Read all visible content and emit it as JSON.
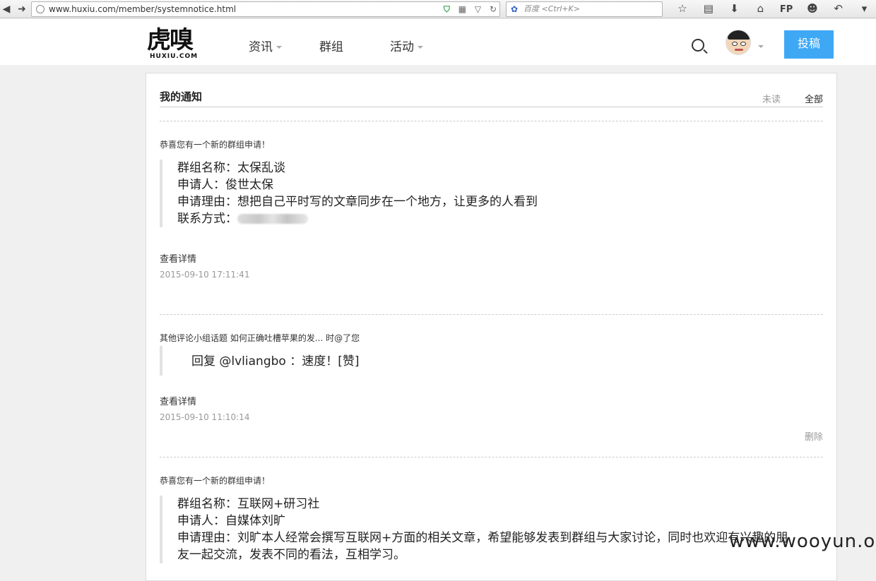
{
  "browser": {
    "url": "www.huxiu.com/member/systemnotice.html",
    "search_placeholder": "百度 <Ctrl+K>",
    "fp_label": "FP"
  },
  "header": {
    "logo_cn": "虎嗅",
    "logo_en": "HUXIU.COM",
    "nav": [
      {
        "label": "资讯",
        "dropdown": true
      },
      {
        "label": "群组",
        "dropdown": false
      },
      {
        "label": "活动",
        "dropdown": true
      }
    ],
    "submit_label": "投稿",
    "accent": "#3ea8f5"
  },
  "notices_panel": {
    "title": "我的通知",
    "filter_unread": "未读",
    "filter_all": "全部"
  },
  "notices": [
    {
      "title": "恭喜您有一个新的群组申请！",
      "lines": [
        "群组名称：太保乱谈",
        "申请人：俊世太保",
        "申请理由：想把自己平时写的文章同步在一个地方，让更多的人看到",
        "联系方式："
      ],
      "detail_label": "查看详情",
      "timestamp": "2015-09-10 17:11:41"
    },
    {
      "title": "其他评论小组话题 如何正确吐槽苹果的发... 时@了您",
      "lines": [
        "回复 @lvliangbo ：速度！[赞]"
      ],
      "detail_label": "查看详情",
      "timestamp": "2015-09-10 11:10:14",
      "delete_label": "删除"
    },
    {
      "title": "恭喜您有一个新的群组申请！",
      "lines": [
        "群组名称：互联网+研习社",
        "申请人：自媒体刘旷",
        "申请理由：刘旷本人经常会撰写互联网+方面的相关文章，希望能够发表到群组与大家讨论，同时也欢迎有兴趣的朋",
        "友一起交流，发表不同的看法，互相学习。"
      ]
    }
  ],
  "watermark": "www.wooyun.org"
}
